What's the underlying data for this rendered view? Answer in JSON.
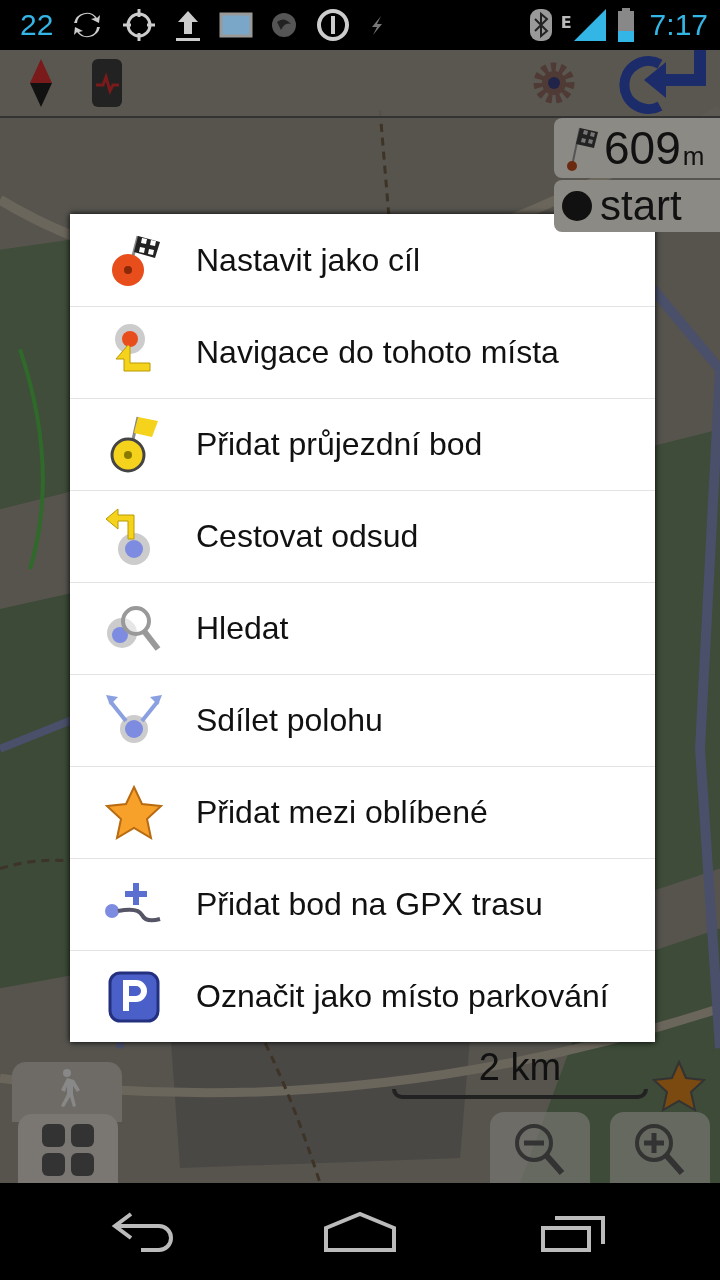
{
  "status_bar": {
    "notification_count": "22",
    "network_type": "E",
    "time": "7:17"
  },
  "map": {
    "distance": {
      "value": "609",
      "unit": "m"
    },
    "route_label": "start",
    "scale": "2 km"
  },
  "context_menu": {
    "items": [
      {
        "label": "Nastavit jako cíl"
      },
      {
        "label": "Navigace do tohoto místa"
      },
      {
        "label": "Přidat průjezdní bod"
      },
      {
        "label": "Cestovat odsud"
      },
      {
        "label": "Hledat"
      },
      {
        "label": "Sdílet polohu"
      },
      {
        "label": "Přidat mezi oblíbené"
      },
      {
        "label": "Přidat bod na GPX trasu"
      },
      {
        "label": "Označit jako místo parkování"
      }
    ]
  }
}
